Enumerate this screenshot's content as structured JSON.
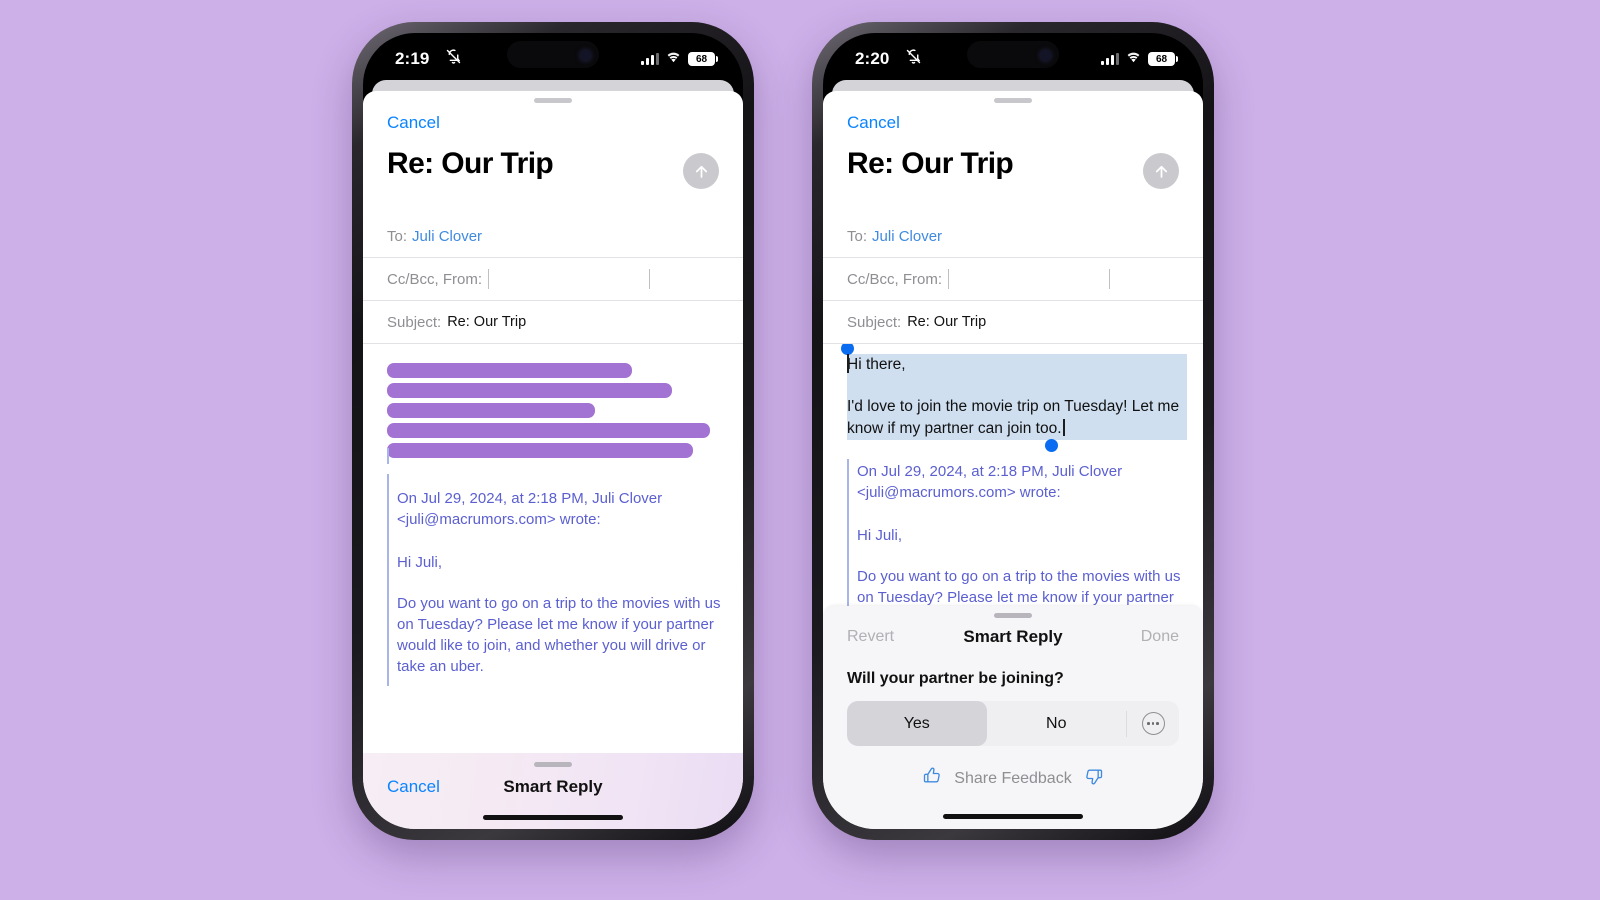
{
  "background_color": "#cdb0e8",
  "accent_blue": "#0a84ff",
  "redaction_color": "#a373d4",
  "selection_color": "#cfdff0",
  "phones": [
    {
      "id": "phone-left",
      "status_bar": {
        "time": "2:19",
        "mute_icon": "bell-slash-icon",
        "signal_icon": "cellular-bars-icon",
        "wifi_icon": "wifi-icon",
        "battery": "68"
      },
      "compose": {
        "cancel_label": "Cancel",
        "title": "Re: Our Trip",
        "send_icon": "arrow-up-circle-icon",
        "to_label": "To:",
        "to_value": "Juli Clover",
        "ccbcc_label": "Cc/Bcc, From:",
        "ccbcc_value": "",
        "subject_label": "Subject:",
        "subject_value": "Re: Our Trip",
        "redacted_bar_widths": [
          245,
          285,
          208,
          323,
          306
        ],
        "quoted_header_line1": "On Jul 29, 2024, at 2:18 PM, Juli Clover",
        "quoted_header_line2": "<juli@macrumors.com> wrote:",
        "quoted_greeting": "Hi Juli,",
        "quoted_body": "Do you want to go on a trip to the movies with us on Tuesday? Please let me know if your partner would like to join, and whether you will drive or take an uber."
      },
      "smart_reply_bar": {
        "cancel_label": "Cancel",
        "title": "Smart Reply"
      }
    },
    {
      "id": "phone-right",
      "status_bar": {
        "time": "2:20",
        "mute_icon": "bell-slash-icon",
        "signal_icon": "cellular-bars-icon",
        "wifi_icon": "wifi-icon",
        "battery": "68"
      },
      "compose": {
        "cancel_label": "Cancel",
        "title": "Re: Our Trip",
        "send_icon": "arrow-up-circle-icon",
        "to_label": "To:",
        "to_value": "Juli Clover",
        "ccbcc_label": "Cc/Bcc, From:",
        "ccbcc_value": "",
        "subject_label": "Subject:",
        "subject_value": "Re: Our Trip",
        "selected_greeting": "Hi there,",
        "selected_body": "I'd love to join the movie trip on Tuesday! Let me know if my partner can join too.",
        "quoted_header_line1": "On Jul 29, 2024, at 2:18 PM, Juli Clover",
        "quoted_header_line2": "<juli@macrumors.com> wrote:",
        "quoted_greeting": "Hi Juli,",
        "quoted_body": "Do you want to go on a trip to the movies with us on Tuesday? Please let me know if your partner would like to join, and whether you will drive or take"
      },
      "smart_reply_panel": {
        "revert_label": "Revert",
        "title": "Smart Reply",
        "done_label": "Done",
        "question": "Will your partner be joining?",
        "options": [
          {
            "label": "Yes",
            "selected": true
          },
          {
            "label": "No",
            "selected": false
          }
        ],
        "more_icon": "ellipsis-circle-icon",
        "feedback_label": "Share Feedback",
        "thumbs_up_icon": "thumbs-up-icon",
        "thumbs_down_icon": "thumbs-down-icon"
      }
    }
  ]
}
